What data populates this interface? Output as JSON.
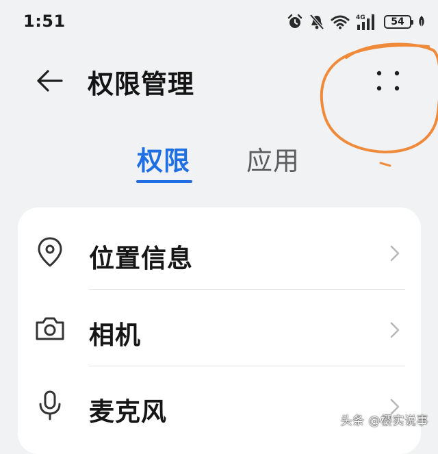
{
  "status_bar": {
    "time": "1:51",
    "network": "4G",
    "battery": "54",
    "icons": [
      "alarm-icon",
      "bell-muted-icon",
      "wifi-icon",
      "signal-4g-icon",
      "battery-icon",
      "leaf-icon"
    ]
  },
  "header": {
    "back_icon": "arrow-left-icon",
    "title": "权限管理",
    "more_icon": "four-dots-menu-icon"
  },
  "tabs": [
    {
      "label": "权限",
      "active": true
    },
    {
      "label": "应用",
      "active": false
    }
  ],
  "list": {
    "items": [
      {
        "label": "位置信息",
        "icon": "location-pin-icon"
      },
      {
        "label": "相机",
        "icon": "camera-icon"
      },
      {
        "label": "麦克风",
        "icon": "microphone-icon"
      }
    ]
  },
  "colors": {
    "accent": "#1f6fe4",
    "background": "#f1f2f4",
    "card": "#ffffff",
    "annotation": "#ef8a3a"
  },
  "watermark": "头条 @樱实说事"
}
